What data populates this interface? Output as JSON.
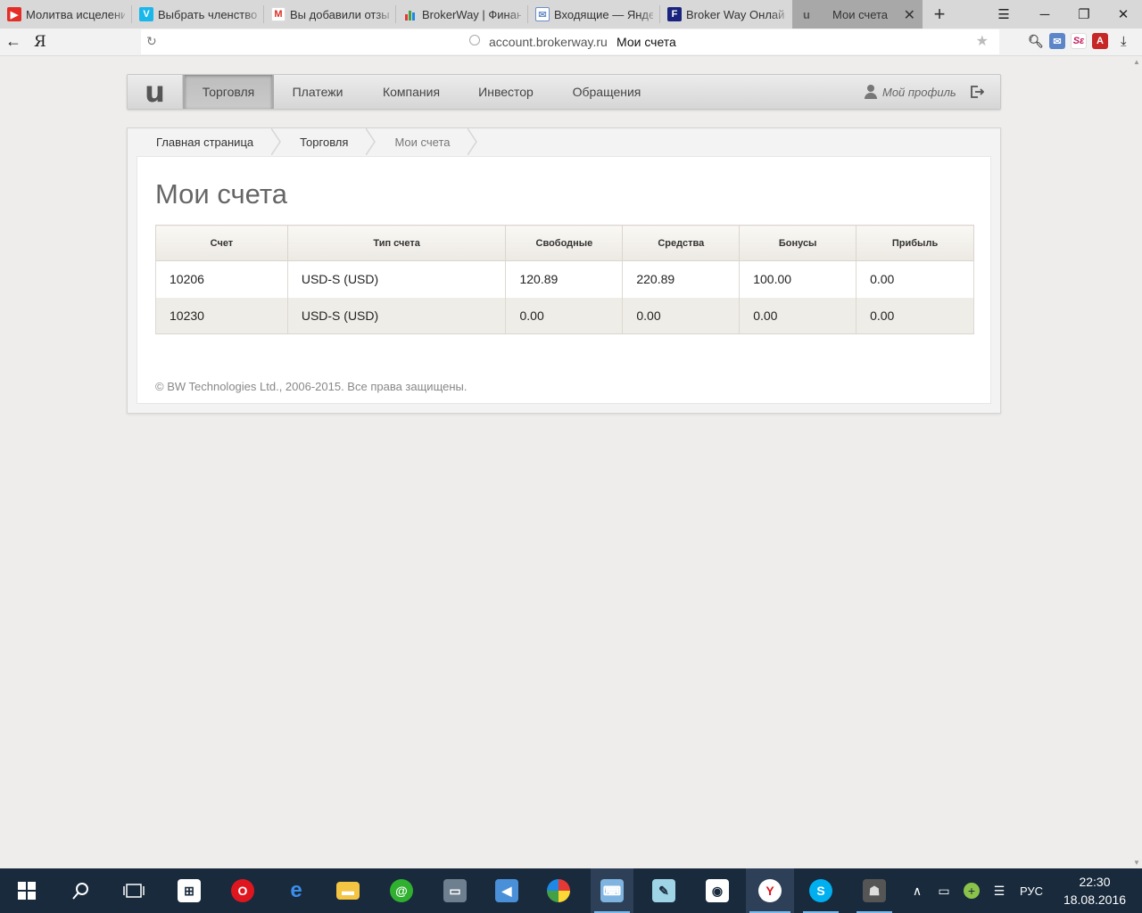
{
  "browser": {
    "tabs": [
      {
        "title": "Молитва исцелени",
        "favicon": "youtube-icon"
      },
      {
        "title": "Выбрать членство",
        "favicon": "vimeo-icon"
      },
      {
        "title": "Вы добавили отзы",
        "favicon": "gmail-icon"
      },
      {
        "title": "BrokerWay | Финан",
        "favicon": "chart-icon"
      },
      {
        "title": "Входящие — Янде",
        "favicon": "mail-icon"
      },
      {
        "title": "Broker Way Онлайн",
        "favicon": "f-icon"
      },
      {
        "title": "Мои счета",
        "favicon": "u-icon",
        "active": true
      }
    ],
    "yandex_logo": "Я",
    "url_host": "account.brokerway.ru",
    "url_title": "Мои счета",
    "extensions": [
      "lens-icon",
      "envelope-icon",
      "se-icon",
      "acrobat-icon"
    ]
  },
  "site": {
    "logo": "u",
    "nav": [
      {
        "label": "Торговля",
        "active": true
      },
      {
        "label": "Платежи"
      },
      {
        "label": "Компания"
      },
      {
        "label": "Инвестор"
      },
      {
        "label": "Обращения"
      }
    ],
    "profile_label": "Мой профиль"
  },
  "breadcrumb": [
    "Главная страница",
    "Торговля",
    "Мои счета"
  ],
  "page_title": "Мои счета",
  "accounts_table": {
    "headers": [
      "Счет",
      "Тип счета",
      "Свободные",
      "Средства",
      "Бонусы",
      "Прибыль"
    ],
    "rows": [
      [
        "10206",
        "USD-S (USD)",
        "120.89",
        "220.89",
        "100.00",
        "0.00"
      ],
      [
        "10230",
        "USD-S (USD)",
        "0.00",
        "0.00",
        "0.00",
        "0.00"
      ]
    ]
  },
  "footer": "© BW Technologies Ltd., 2006-2015. Все права защищены.",
  "taskbar": {
    "apps": [
      "windows-start-icon",
      "search-icon",
      "task-view-icon",
      "store-icon",
      "opera-icon",
      "edge-icon",
      "file-explorer-icon",
      "mail-ru-agent-icon",
      "computer-icon",
      "speaker-app-icon",
      "browser-ball-icon",
      "keyboard-app-icon",
      "notepad-icon",
      "camera-icon",
      "yandex-browser-icon",
      "skype-icon",
      "ghost-app-icon"
    ],
    "language": "РУС",
    "time": "22:30",
    "date": "18.08.2016"
  }
}
